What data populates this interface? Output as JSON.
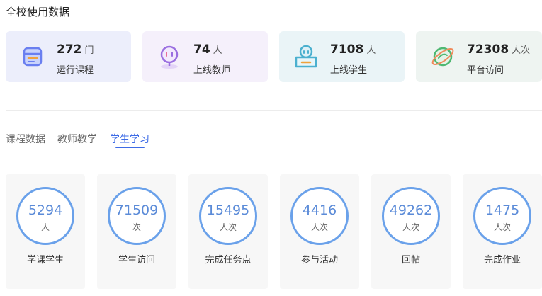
{
  "page": {
    "title": "全校使用数据"
  },
  "stats": [
    {
      "value": "272",
      "unit": "门",
      "label": "运行课程",
      "icon": "course-book-icon"
    },
    {
      "value": "74",
      "unit": "人",
      "label": "上线教师",
      "icon": "teacher-icon"
    },
    {
      "value": "7108",
      "unit": "人",
      "label": "上线学生",
      "icon": "student-icon"
    },
    {
      "value": "72308",
      "unit": "人次",
      "label": "平台访问",
      "icon": "planet-icon"
    }
  ],
  "tabs": [
    {
      "label": "课程数据",
      "active": false
    },
    {
      "label": "教师教学",
      "active": false
    },
    {
      "label": "学生学习",
      "active": true
    }
  ],
  "metrics": [
    {
      "value": "5294",
      "unit": "人",
      "label": "学课学生"
    },
    {
      "value": "71509",
      "unit": "次",
      "label": "学生访问"
    },
    {
      "value": "15495",
      "unit": "人次",
      "label": "完成任务点"
    },
    {
      "value": "4416",
      "unit": "人次",
      "label": "参与活动"
    },
    {
      "value": "49262",
      "unit": "人次",
      "label": "回帖"
    },
    {
      "value": "1475",
      "unit": "人次",
      "label": "完成作业"
    }
  ],
  "colors": {
    "accent": "#3d6be6",
    "ring": "#6aa1ea",
    "card_course": "#eceefb",
    "card_teacher": "#f5f0fb",
    "card_student": "#eaf4f7",
    "card_visit": "#eef4f1"
  }
}
